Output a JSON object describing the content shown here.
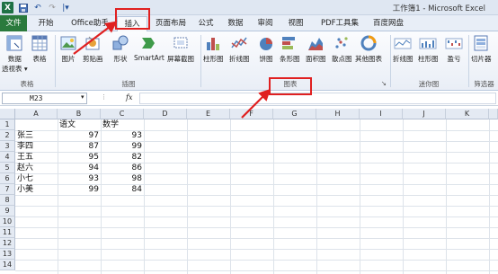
{
  "window": {
    "title": "工作簿1 - Microsoft Excel",
    "app_logo": "X"
  },
  "quick_access": {
    "save_icon": "floppy-icon",
    "undo_glyph": "↶",
    "redo_glyph": "↷",
    "customize_glyph": "|▾"
  },
  "tabs": [
    {
      "label": "文件"
    },
    {
      "label": "开始"
    },
    {
      "label": "Office助手"
    },
    {
      "label": "插入"
    },
    {
      "label": "页面布局"
    },
    {
      "label": "公式"
    },
    {
      "label": "数据"
    },
    {
      "label": "审阅"
    },
    {
      "label": "视图"
    },
    {
      "label": "PDF工具集"
    },
    {
      "label": "百度网盘"
    }
  ],
  "ribbon": {
    "buttons": [
      {
        "label": "数据",
        "label2": "透视表 ▾"
      },
      {
        "label": "表格"
      },
      {
        "label": "图片"
      },
      {
        "label": "剪贴画"
      },
      {
        "label": "形状"
      },
      {
        "label": "SmartArt"
      },
      {
        "label": "屏幕截图"
      },
      {
        "label": "柱形图"
      },
      {
        "label": "折线图"
      },
      {
        "label": "饼图"
      },
      {
        "label": "条形图"
      },
      {
        "label": "面积图"
      },
      {
        "label": "散点图"
      },
      {
        "label": "其他图表"
      },
      {
        "label": "折线图"
      },
      {
        "label": "柱形图"
      },
      {
        "label": "盈亏"
      },
      {
        "label": "切片器"
      }
    ],
    "groups": [
      {
        "label": "表格"
      },
      {
        "label": "插图"
      },
      {
        "label": "图表"
      },
      {
        "label": "迷你图"
      },
      {
        "label": "筛选器"
      }
    ],
    "launcher_glyph": "↘"
  },
  "formula_bar": {
    "name_box": "M23",
    "fx": "fx",
    "value": ""
  },
  "columns": [
    "A",
    "B",
    "C",
    "D",
    "E",
    "F",
    "G",
    "H",
    "I",
    "J",
    "K"
  ],
  "rows": [
    "1",
    "2",
    "3",
    "4",
    "5",
    "6",
    "7",
    "8",
    "9",
    "10",
    "11",
    "12",
    "13",
    "14"
  ],
  "sheet": {
    "headers": {
      "b1": "语文",
      "c1": "数学"
    },
    "records": [
      {
        "name": "张三",
        "chinese": "97",
        "math": "93"
      },
      {
        "name": "李四",
        "chinese": "87",
        "math": "99"
      },
      {
        "name": "王五",
        "chinese": "95",
        "math": "82"
      },
      {
        "name": "赵六",
        "chinese": "94",
        "math": "86"
      },
      {
        "name": "小七",
        "chinese": "93",
        "math": "98"
      },
      {
        "name": "小美",
        "chinese": "99",
        "math": "84"
      }
    ]
  },
  "colors": {
    "annotation_red": "#e02020",
    "file_tab_green": "#2a7a3d"
  }
}
